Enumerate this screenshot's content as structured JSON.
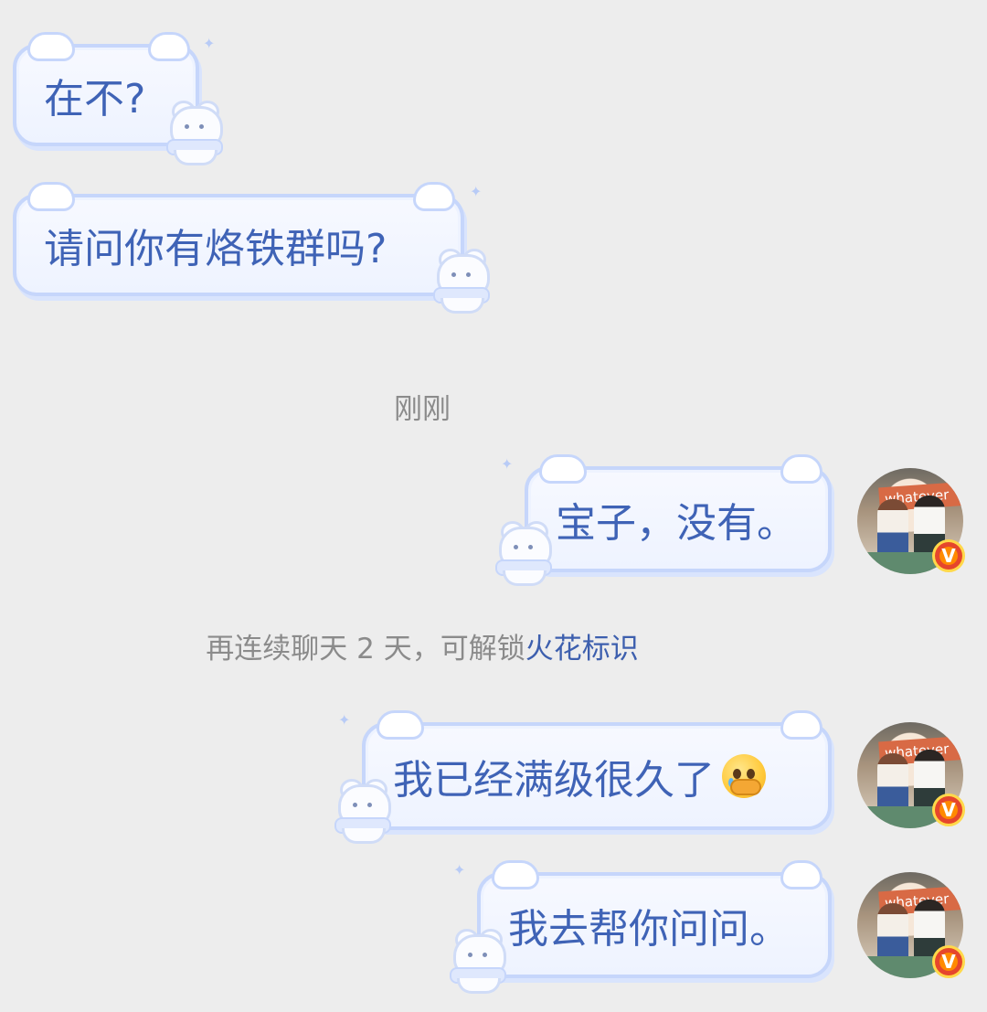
{
  "messages": {
    "m1": {
      "text": "在不?"
    },
    "m2": {
      "text": "请问你有烙铁群吗?"
    },
    "m3": {
      "text": "宝子，没有。"
    },
    "m4": {
      "text": "我已经满级很久了"
    },
    "m5": {
      "text": "我去帮你问问。"
    }
  },
  "timestamp": "刚刚",
  "spark_notice": {
    "prefix": "再连续聊天 2 天，可解锁",
    "link": "火花标识"
  },
  "avatar": {
    "sign_text": "whatever",
    "badge_letter": "V"
  },
  "colors": {
    "bubble_text": "#3f63b6",
    "bubble_border": "#c6d6fb",
    "link": "#3d5fae",
    "background": "#ededed"
  }
}
